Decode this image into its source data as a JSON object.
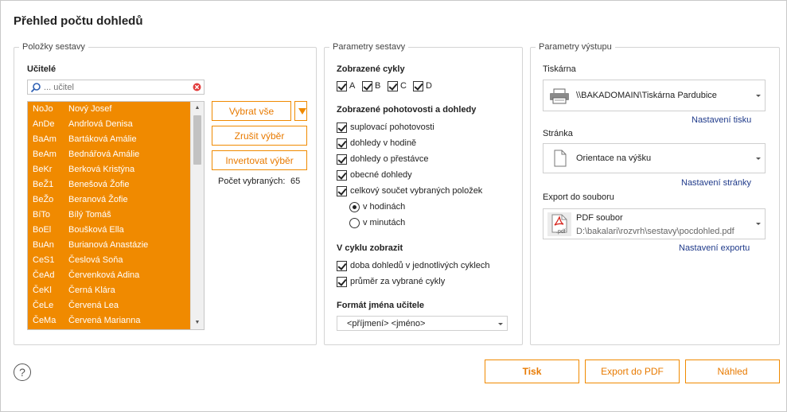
{
  "window": {
    "title": "Přehled počtu dohledů"
  },
  "items_panel": {
    "legend": "Položky sestavy",
    "teachers_label": "Učitelé",
    "search": {
      "placeholder": "... učitel",
      "value": ""
    },
    "teachers": [
      {
        "code": "NoJo",
        "name": "Nový Josef"
      },
      {
        "code": "AnDe",
        "name": "Andrlová Denisa"
      },
      {
        "code": "BaAm",
        "name": "Bartáková Amálie"
      },
      {
        "code": "BeAm",
        "name": "Bednářová Amálie"
      },
      {
        "code": "BeKr",
        "name": "Berková Kristýna"
      },
      {
        "code": "BeŽ1",
        "name": "Benešová Žofie"
      },
      {
        "code": "BeŽo",
        "name": "Beranová Žofie"
      },
      {
        "code": "BíTo",
        "name": "Bílý Tomáš"
      },
      {
        "code": "BoEl",
        "name": "Boušková Ella"
      },
      {
        "code": "BuAn",
        "name": "Burianová Anastázie"
      },
      {
        "code": "CeS1",
        "name": "Česlová Soňa"
      },
      {
        "code": "ČeAd",
        "name": "Červenková Adina"
      },
      {
        "code": "ČeKl",
        "name": "Černá Klára"
      },
      {
        "code": "ČeLe",
        "name": "Červená Lea"
      },
      {
        "code": "ČeMa",
        "name": "Červená Marianna"
      }
    ],
    "buttons": {
      "select_all": "Vybrat vše",
      "cancel_selection": "Zrušit výběr",
      "invert_selection": "Invertovat výběr"
    },
    "selected_count_label": "Počet vybraných:",
    "selected_count": "65"
  },
  "params_panel": {
    "legend": "Parametry sestavy",
    "cycles_label": "Zobrazené cykly",
    "cycles": [
      {
        "label": "A",
        "checked": true
      },
      {
        "label": "B",
        "checked": true
      },
      {
        "label": "C",
        "checked": true
      },
      {
        "label": "D",
        "checked": true
      }
    ],
    "duties_label": "Zobrazené pohotovosti a dohledy",
    "duties": [
      {
        "label": "suplovací pohotovosti",
        "checked": true
      },
      {
        "label": "dohledy v hodině",
        "checked": true
      },
      {
        "label": "dohledy o přestávce",
        "checked": true
      },
      {
        "label": "obecné dohledy",
        "checked": true
      },
      {
        "label": "celkový součet vybraných položek",
        "checked": true
      }
    ],
    "units": [
      {
        "label": "v hodinách",
        "checked": true
      },
      {
        "label": "v minutách",
        "checked": false
      }
    ],
    "in_cycle_label": "V cyklu zobrazit",
    "in_cycle": [
      {
        "label": "doba dohledů v jednotlivých cyklech",
        "checked": true
      },
      {
        "label": "průměr za vybrané cykly",
        "checked": true
      }
    ],
    "name_format_label": "Formát jména učitele",
    "name_format_value": "<příjmení> <jméno>"
  },
  "output_panel": {
    "legend": "Parametry výstupu",
    "printer_label": "Tiskárna",
    "printer_value": "\\\\BAKADOMAIN\\Tiskárna Pardubice",
    "print_settings_link": "Nastavení tisku",
    "page_label": "Stránka",
    "page_value": "Orientace na výšku",
    "page_settings_link": "Nastavení stránky",
    "export_label": "Export do souboru",
    "export_format": "PDF soubor",
    "export_path": "D:\\bakalari\\rozvrh\\sestavy\\pocdohled.pdf",
    "export_icon_text": ".pdf",
    "export_settings_link": "Nastavení exportu"
  },
  "footer": {
    "help_glyph": "?",
    "print_button": "Tisk",
    "export_pdf_button": "Export do PDF",
    "preview_button": "Náhled"
  },
  "colors": {
    "accent": "#f08a00",
    "link": "#1f3a8a"
  }
}
